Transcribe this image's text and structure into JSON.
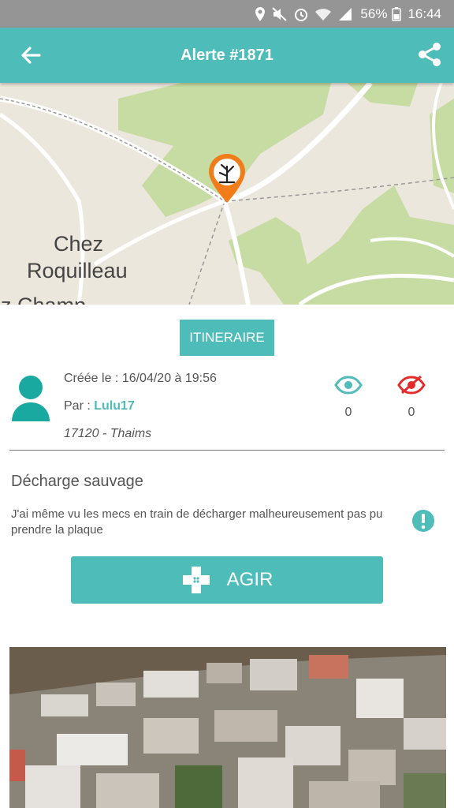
{
  "status_bar": {
    "battery": "56%",
    "time": "16:44"
  },
  "header": {
    "title": "Alerte #1871"
  },
  "map": {
    "places": [
      "Chez",
      "Roquilleau",
      "ez Champ"
    ]
  },
  "itinerary_button": "ITINERAIRE",
  "alert_info": {
    "created": "Créée le : 16/04/20 à 19:56",
    "by_prefix": "Par : ",
    "username": "Lulu17",
    "location": "17120 - Thaims"
  },
  "stats": {
    "views": "0",
    "hidden": "0"
  },
  "colors": {
    "accent": "#4ebcb8",
    "marker": "#f07c1a",
    "danger": "#e32b2b"
  },
  "alert": {
    "title": "Décharge sauvage",
    "description": "J'ai même vu les mecs en train de décharger malheureusement pas pu prendre la plaque"
  },
  "action_button": "AGIR"
}
